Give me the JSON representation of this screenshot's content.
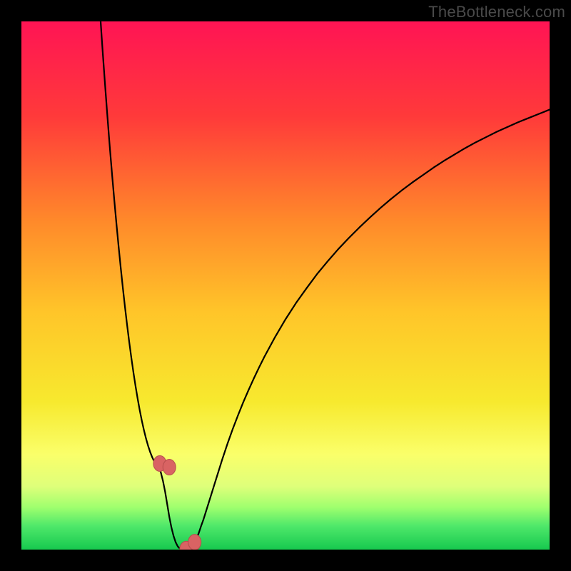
{
  "watermark": "TheBottleneck.com",
  "colors": {
    "black": "#000000",
    "curve": "#000000",
    "marker_fill": "#d96363",
    "marker_stroke": "#b74e4e",
    "gradient_stops": [
      {
        "offset": 0.0,
        "color": "#ff1454"
      },
      {
        "offset": 0.18,
        "color": "#ff3a3a"
      },
      {
        "offset": 0.38,
        "color": "#ff8a2a"
      },
      {
        "offset": 0.55,
        "color": "#ffc529"
      },
      {
        "offset": 0.72,
        "color": "#f7e92e"
      },
      {
        "offset": 0.82,
        "color": "#faff6a"
      },
      {
        "offset": 0.88,
        "color": "#dfff7a"
      },
      {
        "offset": 0.92,
        "color": "#9fff6e"
      },
      {
        "offset": 0.955,
        "color": "#4fe86a"
      },
      {
        "offset": 1.0,
        "color": "#17c94f"
      }
    ]
  },
  "chart_data": {
    "type": "line",
    "title": "",
    "xlabel": "",
    "ylabel": "",
    "xlim": [
      0,
      100
    ],
    "ylim": [
      0,
      100
    ],
    "x": [
      15.0,
      15.2,
      15.4,
      15.6,
      15.8,
      16.0,
      16.2,
      16.4,
      16.6,
      16.8,
      17.0,
      17.2,
      17.4,
      17.6,
      17.8,
      18.0,
      18.2,
      18.4,
      18.6,
      18.8,
      19.0,
      19.2,
      19.4,
      19.6,
      19.8,
      20.0,
      20.2,
      20.4,
      20.6,
      20.8,
      21.0,
      21.2,
      21.4,
      21.6,
      21.8,
      22.0,
      22.2,
      22.4,
      22.6,
      22.8,
      23.0,
      23.2,
      23.4,
      23.6,
      23.8,
      24.0,
      24.2,
      24.4,
      24.6,
      24.8,
      25.0,
      25.2,
      25.4,
      25.6,
      25.8,
      26.0,
      26.2,
      26.4,
      26.6,
      26.8,
      27.0,
      27.2,
      27.4,
      27.6,
      27.8,
      28.0,
      28.2,
      28.4,
      28.6,
      28.8,
      29.0,
      29.2,
      29.4,
      29.6,
      29.8,
      30.0,
      30.4,
      30.8,
      31.2,
      31.6,
      32.0,
      32.4,
      32.8,
      33.2,
      33.6,
      34.0,
      34.5,
      35.0,
      35.5,
      36.0,
      36.5,
      37.0,
      37.5,
      38.0,
      39.0,
      40.0,
      41.0,
      42.0,
      43.0,
      44.0,
      45.0,
      46.0,
      48.0,
      50.0,
      52.0,
      54.0,
      56.0,
      58.0,
      60.0,
      62.0,
      64.0,
      66.0,
      68.0,
      70.0,
      72.0,
      74.0,
      76.0,
      78.0,
      80.0,
      82.0,
      84.0,
      86.0,
      88.0,
      90.0,
      92.0,
      94.0,
      96.0,
      98.0,
      100.0
    ],
    "values": [
      100.0,
      97.0,
      94.1,
      91.3,
      88.5,
      85.8,
      83.1,
      80.5,
      77.9,
      75.4,
      73.0,
      70.6,
      68.3,
      66.0,
      63.8,
      61.6,
      59.5,
      57.4,
      55.4,
      53.4,
      51.5,
      49.6,
      47.8,
      46.0,
      44.3,
      42.6,
      41.0,
      39.4,
      37.9,
      36.4,
      35.0,
      33.6,
      32.3,
      31.0,
      29.8,
      28.6,
      27.5,
      26.4,
      25.4,
      24.4,
      23.5,
      22.6,
      21.8,
      21.0,
      20.3,
      19.6,
      19.0,
      18.4,
      17.9,
      17.4,
      17.0,
      16.6,
      16.3,
      16.0,
      15.8,
      15.6,
      15.2,
      14.6,
      13.8,
      13.0,
      12.0,
      11.0,
      9.8,
      8.6,
      7.4,
      6.2,
      5.2,
      4.2,
      3.4,
      2.6,
      2.0,
      1.4,
      1.0,
      0.6,
      0.4,
      0.2,
      0.1,
      0.1,
      0.1,
      0.2,
      0.4,
      0.8,
      1.4,
      2.2,
      3.2,
      4.4,
      5.8,
      7.4,
      9.0,
      10.6,
      12.2,
      13.8,
      15.4,
      17.0,
      20.0,
      22.8,
      25.4,
      27.9,
      30.2,
      32.4,
      34.5,
      36.5,
      40.2,
      43.6,
      46.7,
      49.5,
      52.2,
      54.6,
      56.9,
      59.0,
      61.0,
      62.9,
      64.7,
      66.4,
      68.0,
      69.5,
      70.9,
      72.3,
      73.6,
      74.8,
      76.0,
      77.1,
      78.1,
      79.1,
      80.0,
      80.9,
      81.7,
      82.5,
      83.3
    ],
    "markers": {
      "x": [
        26.2,
        28.0,
        31.2,
        32.8
      ],
      "y": [
        16.3,
        15.6,
        0.1,
        1.4
      ]
    }
  }
}
